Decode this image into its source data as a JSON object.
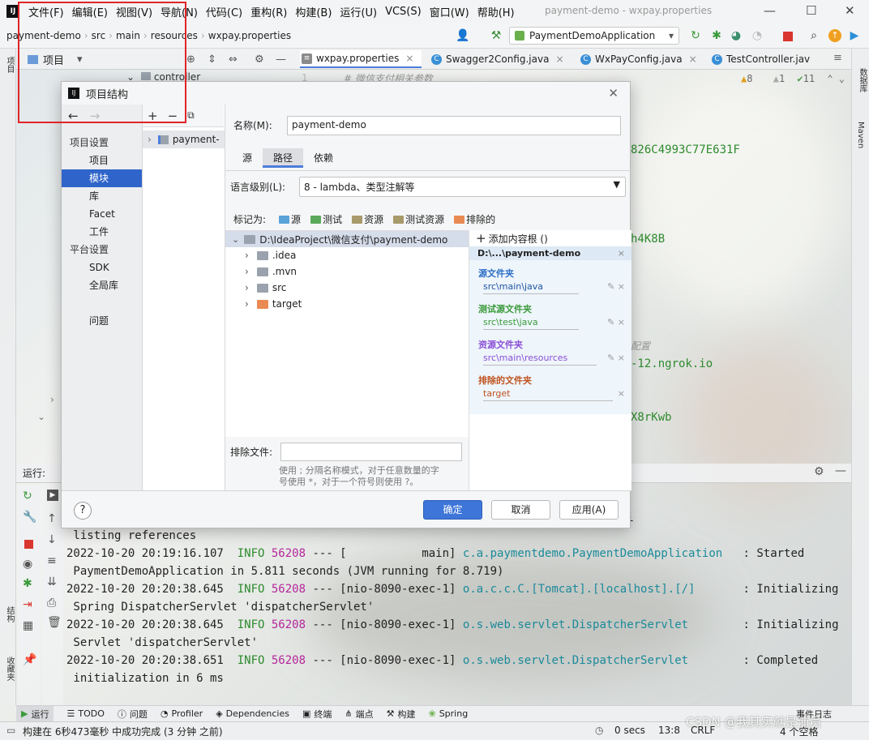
{
  "menu": [
    "文件(F)",
    "编辑(E)",
    "视图(V)",
    "导航(N)",
    "代码(C)",
    "重构(R)",
    "构建(B)",
    "运行(U)",
    "VCS(S)",
    "窗口(W)",
    "帮助(H)"
  ],
  "window_title": "payment-demo - wxpay.properties",
  "breadcrumbs": [
    "payment-demo",
    "src",
    "main",
    "resources",
    "wxpay.properties"
  ],
  "run_config": "PaymentDemoApplication",
  "project_panel_title": "项目",
  "editor_tabs": [
    "wxpay.properties",
    "Swagger2Config.java",
    "WxPayConfig.java",
    "TestController.jav"
  ],
  "tree_bg_item": "controller",
  "editor_inspections": {
    "warnings": "8",
    "weak": "1",
    "ok": "11"
  },
  "editor_snippets": [
    "# 微信支付相关参数",
    "826C4993C77E631F",
    "h4K8B",
    "配置",
    "-12.ngrok.io",
    "X8rKwb"
  ],
  "right_strip": [
    "数据库",
    "Maven"
  ],
  "left_strip": [
    "项目",
    "结构",
    "收藏夹"
  ],
  "run_label": "运行:",
  "console_lines": [
    {
      "parts": [
        {
          "t": "",
          "c": ""
        },
        {
          "t": "eScanner",
          "c": "cls"
        },
        {
          "t": "    : Scanning for api",
          "c": ""
        }
      ],
      "indent": "                                                     "
    },
    {
      "parts": [
        {
          "t": " listing references",
          "c": ""
        }
      ]
    },
    {
      "parts": [
        {
          "t": "2022-10-20 20:19:16.107  ",
          "c": ""
        },
        {
          "t": "INFO",
          "c": "info"
        },
        {
          "t": " ",
          "c": ""
        },
        {
          "t": "56208",
          "c": "pid"
        },
        {
          "t": " --- [           main] ",
          "c": ""
        },
        {
          "t": "c.a.paymentdemo.PaymentDemoApplication",
          "c": "cls"
        },
        {
          "t": "   : Started",
          "c": ""
        }
      ]
    },
    {
      "parts": [
        {
          "t": " PaymentDemoApplication in 5.811 seconds (JVM running for 8.719)",
          "c": ""
        }
      ]
    },
    {
      "parts": [
        {
          "t": "2022-10-20 20:20:38.645  ",
          "c": ""
        },
        {
          "t": "INFO",
          "c": "info"
        },
        {
          "t": " ",
          "c": ""
        },
        {
          "t": "56208",
          "c": "pid"
        },
        {
          "t": " --- [nio-8090-exec-1] ",
          "c": ""
        },
        {
          "t": "o.a.c.c.C.[Tomcat].[localhost].[/]",
          "c": "cls"
        },
        {
          "t": "       : Initializing",
          "c": ""
        }
      ]
    },
    {
      "parts": [
        {
          "t": " Spring DispatcherServlet 'dispatcherServlet'",
          "c": ""
        }
      ]
    },
    {
      "parts": [
        {
          "t": "2022-10-20 20:20:38.645  ",
          "c": ""
        },
        {
          "t": "INFO",
          "c": "info"
        },
        {
          "t": " ",
          "c": ""
        },
        {
          "t": "56208",
          "c": "pid"
        },
        {
          "t": " --- [nio-8090-exec-1] ",
          "c": ""
        },
        {
          "t": "o.s.web.servlet.DispatcherServlet",
          "c": "cls"
        },
        {
          "t": "        : Initializing",
          "c": ""
        }
      ]
    },
    {
      "parts": [
        {
          "t": " Servlet 'dispatcherServlet'",
          "c": ""
        }
      ]
    },
    {
      "parts": [
        {
          "t": "2022-10-20 20:20:38.651  ",
          "c": ""
        },
        {
          "t": "INFO",
          "c": "info"
        },
        {
          "t": " ",
          "c": ""
        },
        {
          "t": "56208",
          "c": "pid"
        },
        {
          "t": " --- [nio-8090-exec-1] ",
          "c": ""
        },
        {
          "t": "o.s.web.servlet.DispatcherServlet",
          "c": "cls"
        },
        {
          "t": "        : Completed",
          "c": ""
        }
      ]
    },
    {
      "parts": [
        {
          "t": " initialization in 6 ms",
          "c": ""
        }
      ]
    }
  ],
  "bottom_tabs": [
    "运行",
    "TODO",
    "问题",
    "Profiler",
    "Dependencies",
    "终端",
    "端点",
    "构建",
    "Spring"
  ],
  "event_log": "事件日志",
  "status": {
    "left": "构建在 6秒473毫秒 中成功完成 (3 分钟 之前)",
    "secs": "0 secs",
    "pos": "13:8",
    "crlf": "CRLF",
    "indent": "4 个空格"
  },
  "watermark": "CSDN @我其实就是浦员",
  "dialog": {
    "title": "项目结构",
    "nav_sections": [
      {
        "head": "项目设置",
        "items": [
          "项目",
          "模块",
          "库",
          "Facet",
          "工件"
        ]
      },
      {
        "head": "平台设置",
        "items": [
          "SDK",
          "全局库"
        ]
      },
      {
        "head": "",
        "items": [
          "问题"
        ]
      }
    ],
    "selected_nav": "模块",
    "module_name_label": "名称(M):",
    "module_name": "payment-demo",
    "module_list_item": "payment-",
    "tabs": [
      "源",
      "路径",
      "依赖"
    ],
    "selected_tab": "路径",
    "lang_label": "语言级别(L):",
    "lang_value": "8 - lambda、类型注解等",
    "mark_as_label": "标记为:",
    "mark_as": [
      {
        "label": "源",
        "color": "#5aa3d9"
      },
      {
        "label": "测试",
        "color": "#5aa85a"
      },
      {
        "label": "资源",
        "color": "#a89a6a"
      },
      {
        "label": "测试资源",
        "color": "#a89a6a"
      },
      {
        "label": "排除的",
        "color": "#e98a53"
      }
    ],
    "tree_root": "D:\\IdeaProject\\微信支付\\payment-demo",
    "tree_children": [
      {
        "name": ".idea",
        "color": "#9aa3ad"
      },
      {
        "name": ".mvn",
        "color": "#9aa3ad"
      },
      {
        "name": "src",
        "color": "#9aa3ad"
      },
      {
        "name": "target",
        "color": "#ea8a53"
      }
    ],
    "add_root": "添加内容根 ()",
    "root_path": "D:\\...\\payment-demo",
    "roots": [
      {
        "title": "源文件夹",
        "path": "src\\main\\java",
        "color": "#2d6fc7"
      },
      {
        "title": "测试源文件夹",
        "path": "src\\test\\java",
        "color": "#3a9a3a"
      },
      {
        "title": "资源文件夹",
        "path": "src\\main\\resources",
        "color": "#8a4fd6"
      },
      {
        "title": "排除的文件夹",
        "path": "target",
        "color": "#c0531f"
      }
    ],
    "exclude_label": "排除文件:",
    "exclude_hint_1": "使用 ; 分隔名称模式，对于任意数量的字",
    "exclude_hint_2": "号使用 *，对于一个符号则使用 ?。",
    "btn_ok": "确定",
    "btn_cancel": "取消",
    "btn_apply": "应用(A)"
  }
}
